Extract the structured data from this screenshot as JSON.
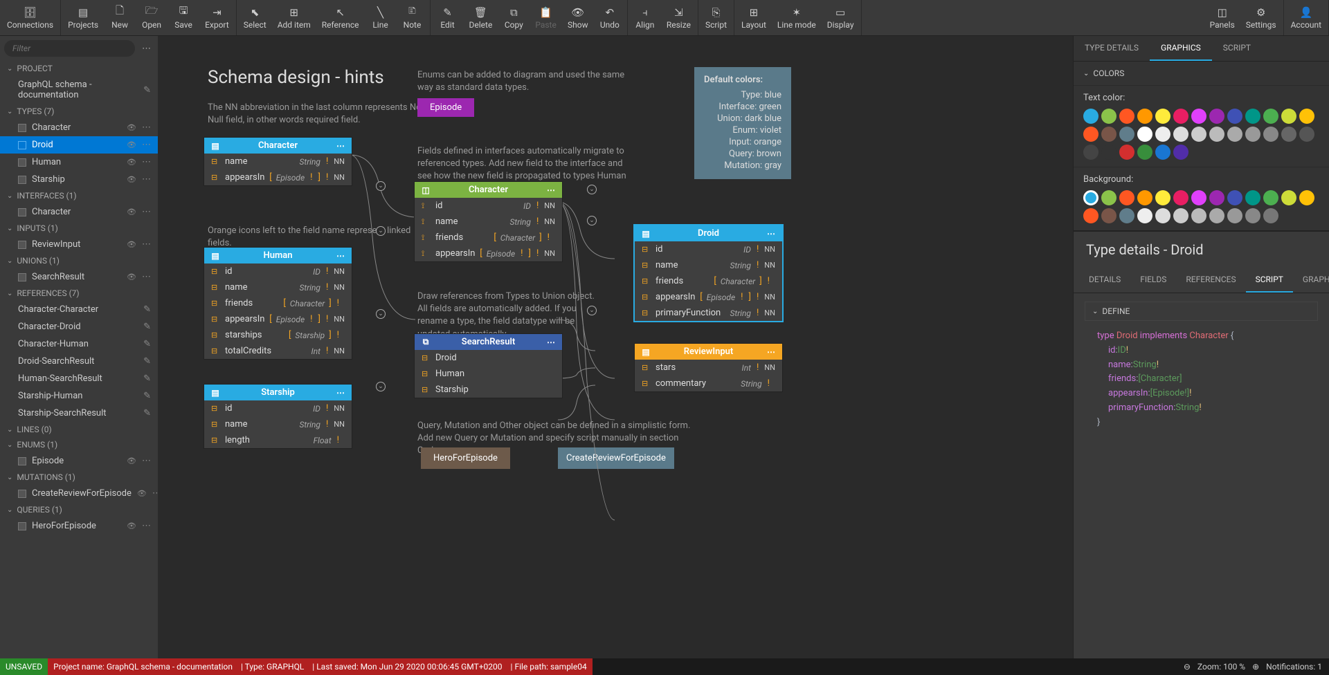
{
  "toolbar": {
    "connections": "Connections",
    "projects": "Projects",
    "new": "New",
    "open": "Open",
    "save": "Save",
    "export": "Export",
    "select": "Select",
    "add_item": "Add item",
    "reference": "Reference",
    "line": "Line",
    "note": "Note",
    "edit": "Edit",
    "delete": "Delete",
    "copy": "Copy",
    "paste": "Paste",
    "show": "Show",
    "undo": "Undo",
    "align": "Align",
    "resize": "Resize",
    "script": "Script",
    "layout": "Layout",
    "line_mode": "Line mode",
    "display": "Display",
    "panels": "Panels",
    "settings": "Settings",
    "account": "Account"
  },
  "sidebar": {
    "filter_placeholder": "Filter",
    "sections": {
      "project": "PROJECT",
      "project_name": "GraphQL schema - documentation",
      "types": "TYPES (7)",
      "interfaces": "INTERFACES (1)",
      "inputs": "INPUTS (1)",
      "unions": "UNIONS (1)",
      "references": "REFERENCES (7)",
      "lines": "LINES (0)",
      "enums": "ENUMS (1)",
      "mutations": "MUTATIONS (1)",
      "queries": "QUERIES (1)"
    },
    "types_items": [
      "Character",
      "Droid",
      "Human",
      "Starship"
    ],
    "interfaces_items": [
      "Character"
    ],
    "inputs_items": [
      "ReviewInput"
    ],
    "unions_items": [
      "SearchResult"
    ],
    "references_items": [
      "Character-Character",
      "Character-Droid",
      "Character-Human",
      "Droid-SearchResult",
      "Human-SearchResult",
      "Starship-Human",
      "Starship-SearchResult"
    ],
    "enums_items": [
      "Episode"
    ],
    "mutations_items": [
      "CreateReviewForEpisode"
    ],
    "queries_items": [
      "HeroForEpisode"
    ]
  },
  "canvas": {
    "title": "Schema design - hints",
    "hint1": "The NN abbreviation in the last column represents Not Null field, in other words required field.",
    "hint2": "Enums can be added to diagram and used the same way as standard data types.",
    "hint3": "Fields defined in interfaces automatically migrate to referenced types. Add new field to the interface and see how the new field is propagated to types Human and Droid.",
    "hint4": "Orange icons left to the field name represent linked fields.",
    "hint5": "Draw references from Types to Union object. All fields are automatically added. If you rename a type, the field datatype will be updated automatically.",
    "hint6": "Query, Mutation and Other object can be defined in a simplistic form. Add new Query or Mutation and specify script manually in section Code.",
    "episode": "Episode",
    "hero_for_episode": "HeroForEpisode",
    "create_review": "CreateReviewForEpisode",
    "default_colors_title": "Default colors:",
    "dc": [
      "Type: blue",
      "Interface: green",
      "Union: dark blue",
      "Enum: violet",
      "Input: orange",
      "Query: brown",
      "Mutation: gray"
    ],
    "nodes": {
      "character_type": {
        "title": "Character",
        "rows": [
          {
            "name": "name",
            "type": "String",
            "nn": "NN"
          },
          {
            "name": "appearsIn",
            "type": "[ Episode ! ]",
            "nn": "NN"
          }
        ]
      },
      "character_iface": {
        "title": "Character",
        "rows": [
          {
            "name": "id",
            "type": "ID",
            "nn": "NN",
            "icon": true
          },
          {
            "name": "name",
            "type": "String",
            "nn": "NN",
            "icon": true
          },
          {
            "name": "friends",
            "type": "[ Character ]",
            "nn": "",
            "icon": true
          },
          {
            "name": "appearsIn",
            "type": "[ Episode ! ]",
            "nn": "NN",
            "icon": true
          }
        ]
      },
      "human": {
        "title": "Human",
        "rows": [
          {
            "name": "id",
            "type": "ID",
            "nn": "NN"
          },
          {
            "name": "name",
            "type": "String",
            "nn": "NN"
          },
          {
            "name": "friends",
            "type": "[ Character ]",
            "nn": ""
          },
          {
            "name": "appearsIn",
            "type": "[ Episode ! ]",
            "nn": "NN"
          },
          {
            "name": "starships",
            "type": "[ Starship ]",
            "nn": ""
          },
          {
            "name": "totalCredits",
            "type": "Int",
            "nn": "NN"
          }
        ]
      },
      "droid": {
        "title": "Droid",
        "rows": [
          {
            "name": "id",
            "type": "ID",
            "nn": "NN"
          },
          {
            "name": "name",
            "type": "String",
            "nn": "NN"
          },
          {
            "name": "friends",
            "type": "[ Character ]",
            "nn": ""
          },
          {
            "name": "appearsIn",
            "type": "[ Episode ! ] !",
            "nn": "NN"
          },
          {
            "name": "primaryFunction",
            "type": "String",
            "nn": "NN"
          }
        ]
      },
      "starship": {
        "title": "Starship",
        "rows": [
          {
            "name": "id",
            "type": "ID",
            "nn": "NN"
          },
          {
            "name": "name",
            "type": "String",
            "nn": "NN"
          },
          {
            "name": "length",
            "type": "Float",
            "nn": ""
          }
        ]
      },
      "searchresult": {
        "title": "SearchResult",
        "rows": [
          {
            "name": "Droid"
          },
          {
            "name": "Human"
          },
          {
            "name": "Starship"
          }
        ]
      },
      "reviewinput": {
        "title": "ReviewInput",
        "rows": [
          {
            "name": "stars",
            "type": "Int",
            "nn": "NN"
          },
          {
            "name": "commentary",
            "type": "String",
            "nn": ""
          }
        ]
      }
    }
  },
  "right_panel": {
    "tabs": [
      "TYPE DETAILS",
      "GRAPHICS",
      "SCRIPT"
    ],
    "colors_section": "COLORS",
    "text_color": "Text color:",
    "background": "Background:",
    "palette1": [
      "#29abe2",
      "#8bc34a",
      "#ff5722",
      "#ff9800",
      "#ffeb3b",
      "#e91e63",
      "#e040fb",
      "#9c27b0",
      "#3f51b5",
      "#009688",
      "#4caf50",
      "#cddc39",
      "#ffc107",
      "#ff5722",
      "#795548",
      "#607d8b",
      "#ffffff",
      "#eeeeee",
      "#dddddd",
      "#cccccc",
      "#bbbbbb",
      "#aaaaaa",
      "#999999",
      "#888888",
      "#666666",
      "#555555",
      "#444444",
      "#333333",
      "#d32f2f",
      "#388e3c",
      "#1976d2",
      "#512da8"
    ],
    "palette2": [
      "#29abe2",
      "#8bc34a",
      "#ff5722",
      "#ff9800",
      "#ffeb3b",
      "#e91e63",
      "#e040fb",
      "#9c27b0",
      "#3f51b5",
      "#009688",
      "#4caf50",
      "#cddc39",
      "#ffc107",
      "#ff5722",
      "#795548",
      "#607d8b",
      "#eeeeee",
      "#dddddd",
      "#cccccc",
      "#bbbbbb",
      "#aaaaaa",
      "#999999",
      "#888888",
      "#777777"
    ]
  },
  "details": {
    "title": "Type details - Droid",
    "tabs": [
      "DETAILS",
      "FIELDS",
      "REFERENCES",
      "SCRIPT",
      "GRAPHICS"
    ],
    "define": "DEFINE",
    "code_type": "type",
    "code_name": "Droid",
    "code_implements": "implements",
    "code_iface": "Character",
    "fields": [
      {
        "name": "id",
        "type": "ID",
        "excl": "!"
      },
      {
        "name": "name",
        "type": "String",
        "excl": "!"
      },
      {
        "name": "friends",
        "type": "[Character]",
        "excl": ""
      },
      {
        "name": "appearsIn",
        "type": "[Episode!]",
        "excl": "!"
      },
      {
        "name": "primaryFunction",
        "type": "String",
        "excl": "!"
      }
    ]
  },
  "statusbar": {
    "unsaved": "UNSAVED",
    "project": "Project name: GraphQL schema - documentation",
    "type": "| Type: GRAPHQL",
    "saved": "| Last saved: Mon Jun 29 2020 00:06:45 GMT+0200",
    "path": "| File path: sample04",
    "zoom": "Zoom: 100 %",
    "notif": "Notifications: 1"
  }
}
